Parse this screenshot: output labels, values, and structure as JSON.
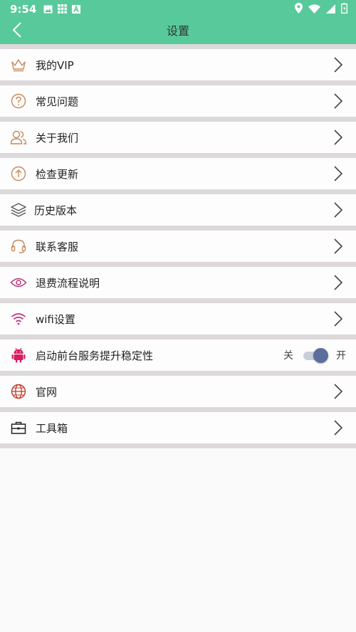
{
  "status": {
    "time": "9:54"
  },
  "header": {
    "title": "设置"
  },
  "rows": [
    {
      "label": "我的VIP"
    },
    {
      "label": "常见问题"
    },
    {
      "label": "关于我们"
    },
    {
      "label": "检查更新"
    },
    {
      "label": "历史版本"
    },
    {
      "label": "联系客服"
    },
    {
      "label": "退费流程说明"
    },
    {
      "label": "wifi设置"
    },
    {
      "label": "启动前台服务提升稳定性",
      "off_label": "关",
      "on_label": "开",
      "enabled": true
    },
    {
      "label": "官网"
    },
    {
      "label": "工具箱"
    }
  ],
  "colors": {
    "primary": "#57c99b",
    "icon_brown": "#c7895a",
    "icon_magenta": "#b8367a",
    "icon_android": "#d81b60",
    "icon_web": "#c0392b",
    "toggle_thumb": "#5b6d9b"
  }
}
